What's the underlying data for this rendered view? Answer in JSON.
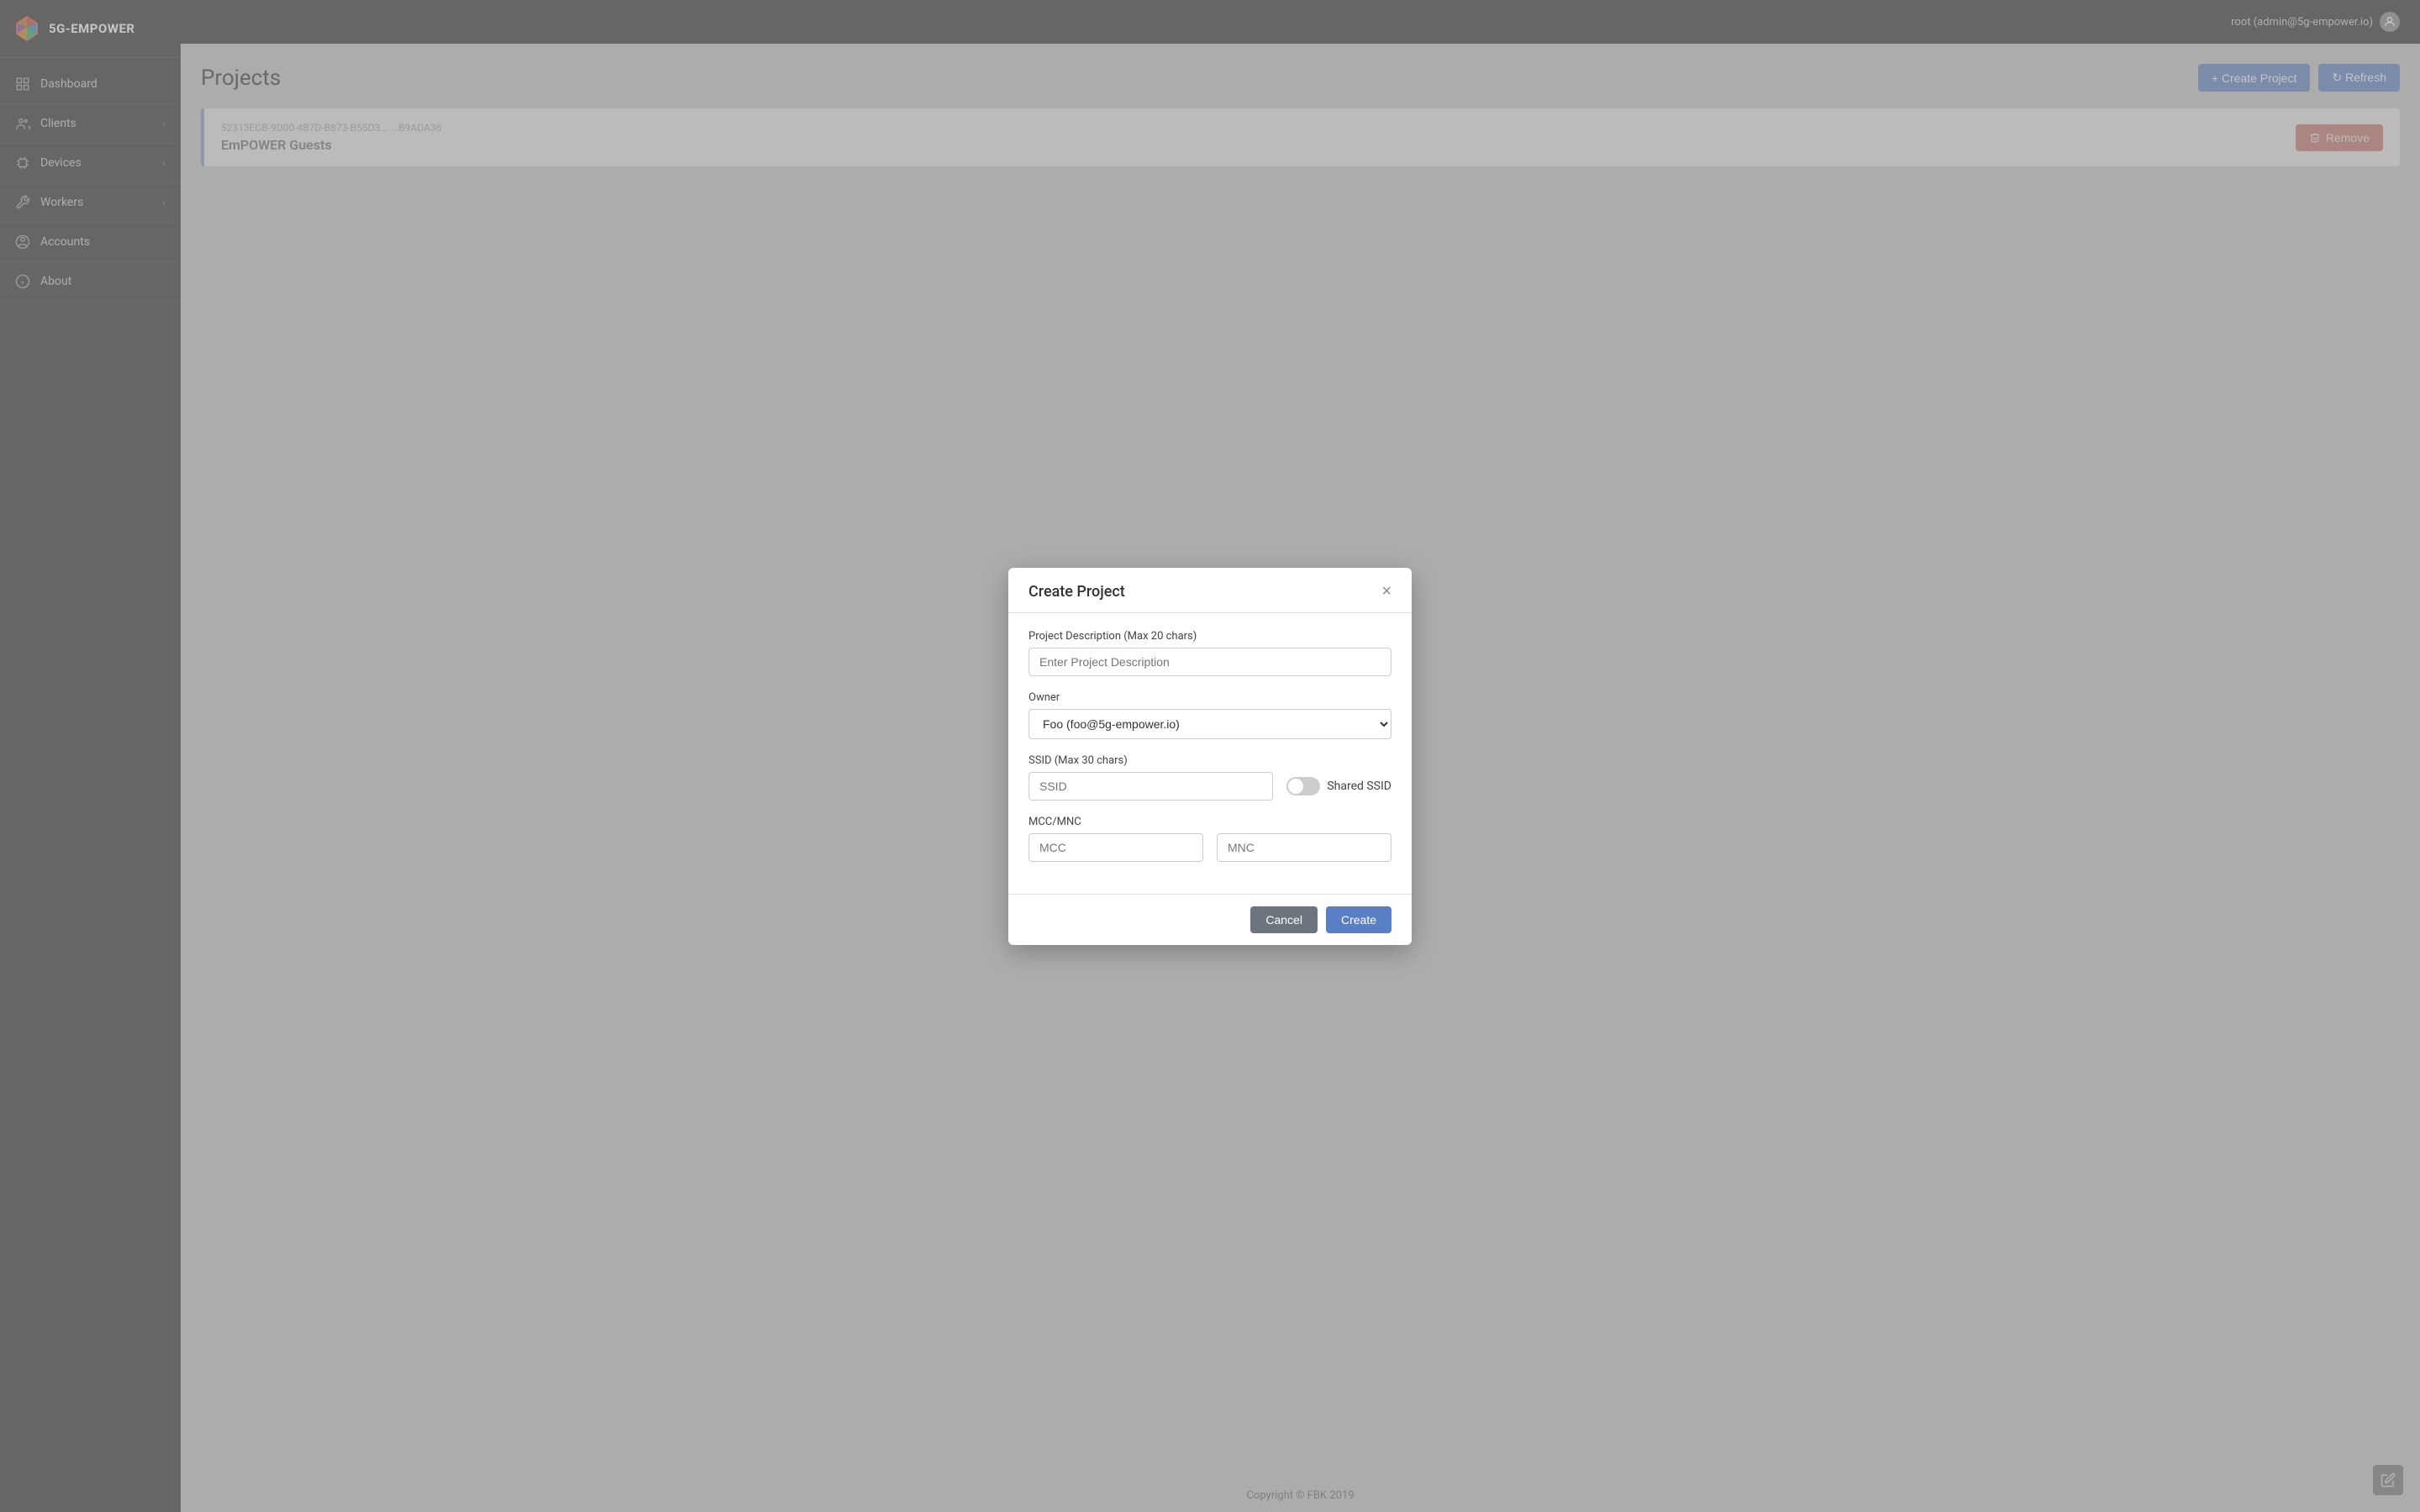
{
  "app": {
    "name": "5G-EMPOWER",
    "logoColors": [
      "#e74c3c",
      "#3498db",
      "#2ecc71",
      "#f39c12"
    ]
  },
  "topbar": {
    "user": "root (admin@5g-empower.io)"
  },
  "sidebar": {
    "items": [
      {
        "id": "dashboard",
        "label": "Dashboard",
        "icon": "grid",
        "hasChevron": false
      },
      {
        "id": "clients",
        "label": "Clients",
        "icon": "users",
        "hasChevron": true
      },
      {
        "id": "devices",
        "label": "Devices",
        "icon": "cpu",
        "hasChevron": true
      },
      {
        "id": "workers",
        "label": "Workers",
        "icon": "tool",
        "hasChevron": true
      },
      {
        "id": "accounts",
        "label": "Accounts",
        "icon": "user-circle",
        "hasChevron": false
      },
      {
        "id": "about",
        "label": "About",
        "icon": "info",
        "hasChevron": false
      }
    ]
  },
  "page": {
    "title": "Projects",
    "create_button": "+ Create Project",
    "refresh_button": "↻ Refresh"
  },
  "projects": [
    {
      "uuid": "52313ECB-9D00-4B7D-B873-B55D3...",
      "uuid_right": "...B9ADA36",
      "name": "EmPOWER Guests",
      "remove_label": "Remove"
    }
  ],
  "modal": {
    "title": "Create Project",
    "close": "×",
    "fields": {
      "description_label": "Project Description (Max 20 chars)",
      "description_placeholder": "Enter Project Description",
      "owner_label": "Owner",
      "owner_value": "Foo (foo@5g-empower.io)",
      "ssid_label": "SSID (Max 30 chars)",
      "ssid_placeholder": "SSID",
      "shared_ssid_label": "Shared SSID",
      "mcc_mnc_label": "MCC/MNC",
      "mcc_placeholder": "MCC",
      "mnc_placeholder": "MNC"
    },
    "cancel_label": "Cancel",
    "create_label": "Create"
  },
  "footer": {
    "text": "Copyright © FBK 2019"
  }
}
